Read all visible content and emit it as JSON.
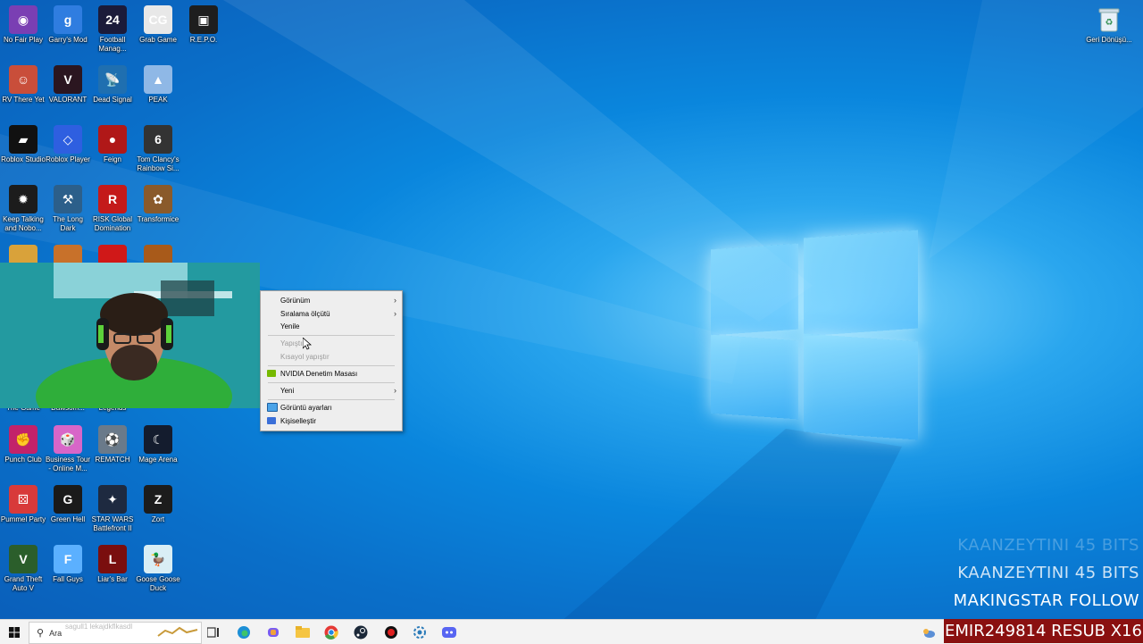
{
  "desktop_icons": [
    {
      "label": "No Fair Play",
      "color": "#7a3fb3",
      "glyph": "◉"
    },
    {
      "label": "Garry's Mod",
      "color": "#2f7de0",
      "glyph": "g"
    },
    {
      "label": "Football Manag...",
      "color": "#1b1b3a",
      "glyph": "24"
    },
    {
      "label": "Grab Game",
      "color": "#e8e8e8",
      "glyph": "CG"
    },
    {
      "label": "R.E.P.O.",
      "color": "#1e1e1e",
      "glyph": "▣"
    },
    {
      "label": "RV There Yet",
      "color": "#c94e3a",
      "glyph": "☺"
    },
    {
      "label": "VALORANT",
      "color": "#2b1620",
      "glyph": "V"
    },
    {
      "label": "Dead Signal",
      "color": "#1f6fb0",
      "glyph": "📡"
    },
    {
      "label": "PEAK",
      "color": "#8fb8e6",
      "glyph": "▲"
    },
    {
      "label": "Roblox Studio",
      "color": "#111111",
      "glyph": "▰"
    },
    {
      "label": "Roblox Player",
      "color": "#2e5fe0",
      "glyph": "◇"
    },
    {
      "label": "Feign",
      "color": "#b01818",
      "glyph": "●"
    },
    {
      "label": "Tom Clancy's Rainbow Si...",
      "color": "#333333",
      "glyph": "6"
    },
    {
      "label": "Keep Talking and Nobo...",
      "color": "#1c1c1c",
      "glyph": "✹"
    },
    {
      "label": "The Long Dark",
      "color": "#2c5f8a",
      "glyph": "⚒"
    },
    {
      "label": "RISK Global Domination",
      "color": "#c41a1a",
      "glyph": "R"
    },
    {
      "label": "Transformice",
      "color": "#8a5a2b",
      "glyph": "✿"
    },
    {
      "label": "Punch Club",
      "color": "#c2226a",
      "glyph": "✊"
    },
    {
      "label": "Business Tour - Online M...",
      "color": "#d866c8",
      "glyph": "🎲"
    },
    {
      "label": "REMATCH",
      "color": "#6a7a8a",
      "glyph": "⚽"
    },
    {
      "label": "Mage Arena",
      "color": "#141c2e",
      "glyph": "☾"
    },
    {
      "label": "Pummel Party",
      "color": "#d83a3a",
      "glyph": "⚄"
    },
    {
      "label": "Green Hell",
      "color": "#1a1a1a",
      "glyph": "G"
    },
    {
      "label": "STAR WARS Battlefront II",
      "color": "#1e2a40",
      "glyph": "✦"
    },
    {
      "label": "Zort",
      "color": "#1c1c1c",
      "glyph": "Z"
    },
    {
      "label": "Grand Theft Auto V",
      "color": "#2b5e2b",
      "glyph": "V"
    },
    {
      "label": "Fall Guys",
      "color": "#5bb0ff",
      "glyph": "F"
    },
    {
      "label": "Liar's Bar",
      "color": "#7a0e0e",
      "glyph": "L"
    },
    {
      "label": "Goose Goose Duck",
      "color": "#d9eef5",
      "glyph": "🦆"
    }
  ],
  "partial_labels": {
    "a": "The Game",
    "b": "Dawsom...",
    "c": "Legends"
  },
  "recycle_bin": {
    "label": "Geri Dönüşü..."
  },
  "context_menu": {
    "items": [
      {
        "label": "Görünüm",
        "submenu": true
      },
      {
        "label": "Sıralama ölçütü",
        "submenu": true
      },
      {
        "label": "Yenile"
      },
      {
        "label": "Yapıştır",
        "disabled": true
      },
      {
        "label": "Kısayol yapıştır",
        "disabled": true
      },
      {
        "label": "NVIDIA Denetim Masası",
        "icon": "nvidia-icon"
      },
      {
        "label": "Yeni",
        "submenu": true
      },
      {
        "label": "Görüntü ayarları",
        "icon": "display-icon"
      },
      {
        "label": "Kişiselleştir",
        "icon": "personalize-icon"
      }
    ]
  },
  "taskbar": {
    "search_placeholder": "Ara",
    "search_overlay": "sagull1 lekajdkflkasdl",
    "start_icon": "windows-start-icon",
    "apps": [
      "task-view-icon",
      "edge-icon",
      "copilot-icon",
      "file-explorer-icon",
      "chrome-icon",
      "steam-icon",
      "app-red-icon",
      "settings-app-icon",
      "discord-icon"
    ]
  },
  "stream_overlay": {
    "line1": "KAANZEYTINI  45 BITS",
    "line2": "KAANZEYTINI  45 BITS",
    "line3": "MAKINGSTAR  FOLLOW",
    "banner": "EMIR249814  RESUB X16"
  },
  "colors": {
    "accent": "#0a86dd",
    "menu_bg": "#eeeeee",
    "banner": "#8a1010"
  }
}
